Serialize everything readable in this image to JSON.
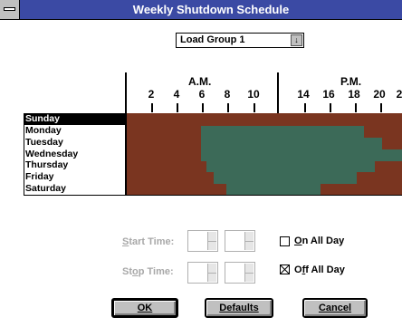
{
  "window": {
    "title": "Weekly Shutdown Schedule"
  },
  "load_group": {
    "selected": "Load Group 1",
    "arrow": "↓"
  },
  "schedule": {
    "am_label": "A.M.",
    "pm_label": "P.M.",
    "hour_ticks": [
      "2",
      "4",
      "6",
      "8",
      "10",
      "14",
      "16",
      "18",
      "20",
      "2"
    ],
    "days": [
      "Sunday",
      "Monday",
      "Tuesday",
      "Wednesday",
      "Thursday",
      "Friday",
      "Saturday"
    ],
    "selected_day": "Sunday",
    "colors": {
      "off": "#7a3520",
      "on": "#3c6a58"
    }
  },
  "controls": {
    "start_time_label_pre": "S",
    "start_time_label_post": "tart Time:",
    "stop_time_label_pre": "St",
    "stop_time_label_accel": "o",
    "stop_time_label_post": "p Time:",
    "on_all_day_pre": "O",
    "on_all_day_post": "n All Day",
    "on_all_day_checked": false,
    "off_all_day_pre": "O",
    "off_all_day_accel": "f",
    "off_all_day_post": "f All Day",
    "off_all_day_checked": true
  },
  "buttons": {
    "ok": "OK",
    "defaults": "Defaults",
    "cancel": "Cancel"
  }
}
